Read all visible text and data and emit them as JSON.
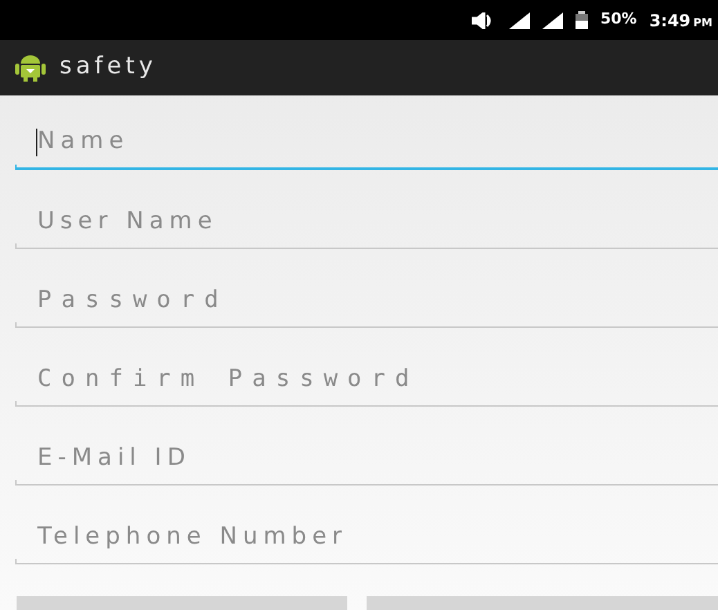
{
  "status_bar": {
    "battery": "50%",
    "time": "3:49",
    "meridiem": "PM"
  },
  "action_bar": {
    "title": "safety"
  },
  "fields": [
    {
      "placeholder": "Name",
      "kind": "text",
      "focused": true
    },
    {
      "placeholder": "User Name",
      "kind": "text",
      "focused": false
    },
    {
      "placeholder": "Password",
      "kind": "password",
      "focused": false
    },
    {
      "placeholder": "Confirm Password",
      "kind": "password",
      "focused": false
    },
    {
      "placeholder": "E-Mail ID",
      "kind": "text",
      "focused": false
    },
    {
      "placeholder": "Telephone Number",
      "kind": "text",
      "focused": false
    }
  ],
  "buttons": [
    {
      "kind": "plain"
    },
    {
      "kind": "plain"
    }
  ]
}
